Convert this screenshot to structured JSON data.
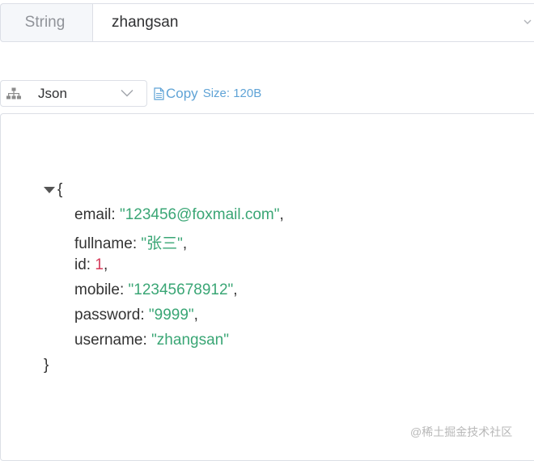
{
  "key_bar": {
    "type_label": "String",
    "key_value": "zhangsan"
  },
  "toolbar": {
    "format": "Json",
    "copy_label": "Copy",
    "size_label": "Size: 120B"
  },
  "json": {
    "open": "{",
    "close": "}",
    "entries": [
      {
        "key": "email",
        "value": "\"123456@foxmail.com\"",
        "type": "string",
        "sep": ","
      },
      {
        "key": "fullname",
        "value": "\"张三\"",
        "type": "string",
        "sep": ","
      },
      {
        "key": "id",
        "value": "1",
        "type": "number",
        "sep": ","
      },
      {
        "key": "mobile",
        "value": "\"12345678912\"",
        "type": "string",
        "sep": ","
      },
      {
        "key": "password",
        "value": "\"9999\"",
        "type": "string",
        "sep": ","
      },
      {
        "key": "username",
        "value": "\"zhangsan\"",
        "type": "string",
        "sep": ""
      }
    ]
  },
  "watermark": "@稀土掘金技术社区",
  "colors": {
    "link": "#5fa3d6",
    "string": "#3aa675",
    "number": "#d63a5a"
  }
}
